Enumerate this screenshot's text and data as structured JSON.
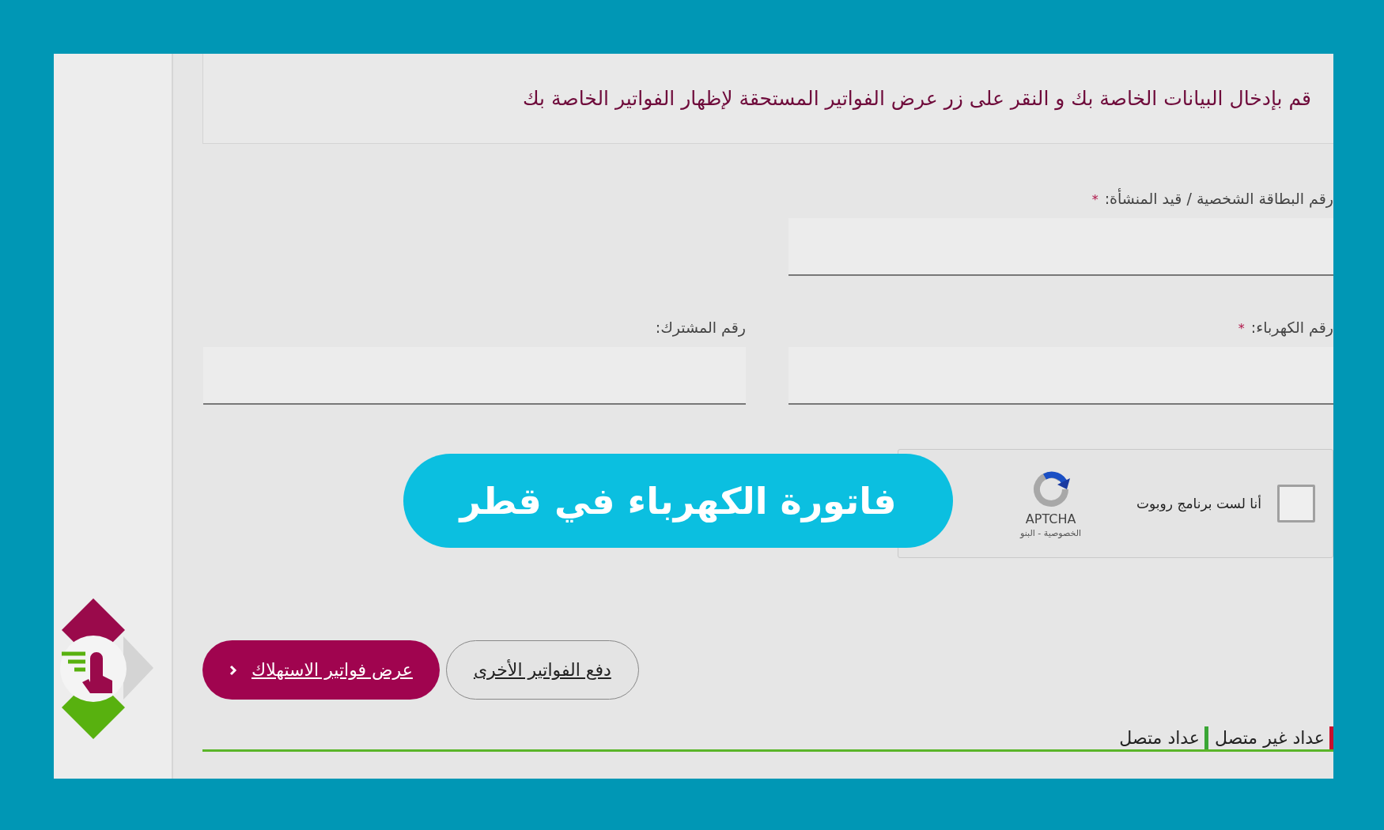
{
  "intro": "قم بإدخال البيانات الخاصة بك و النقر على زر عرض الفواتير المستحقة لإظهار الفواتير الخاصة بك",
  "fields": [
    {
      "label": "رقم البطاقة الشخصية / قيد المنشأة:",
      "required_mark": "*"
    },
    {
      "label": "رقم الكهرباء:",
      "required_mark": "*"
    },
    {
      "label": "رقم المشترك:"
    }
  ],
  "captcha": {
    "checked": false,
    "label": "أنا لست برنامج روبوت",
    "brand": "APTCHA",
    "links": "الخصوصية - البنو"
  },
  "buttons": [
    {
      "label": "دفع الفواتير الأخرى",
      "kind": "secondary"
    },
    {
      "label": "عرض فواتير الاستهلاك",
      "kind": "primary"
    }
  ],
  "tabs": [
    {
      "label": "عداد غير متصل",
      "color": "#c8102e"
    },
    {
      "label": "عداد متصل",
      "color": "#3aa635"
    }
  ],
  "overlay_title": "فاتورة الكهرباء في قطر"
}
